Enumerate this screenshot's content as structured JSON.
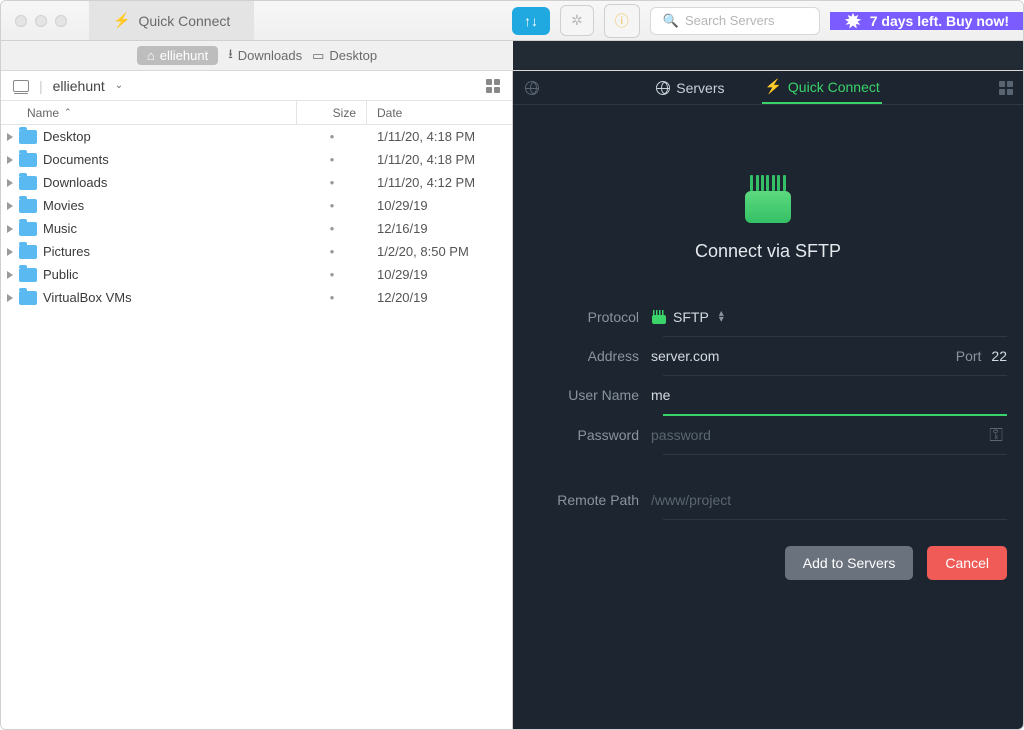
{
  "titlebar": {
    "tab_label": "Quick Connect",
    "search_placeholder": "Search Servers",
    "buy_text": "7 days left. Buy now!"
  },
  "breadcrumbs": [
    {
      "label": "elliehunt",
      "active": true,
      "icon": "home"
    },
    {
      "label": "Downloads",
      "active": false,
      "icon": "download"
    },
    {
      "label": "Desktop",
      "active": false,
      "icon": "desktop"
    }
  ],
  "left": {
    "path_label": "elliehunt",
    "columns": {
      "name": "Name",
      "size": "Size",
      "date": "Date"
    },
    "files": [
      {
        "name": "Desktop",
        "size": "•",
        "date": "1/11/20, 4:18 PM"
      },
      {
        "name": "Documents",
        "size": "•",
        "date": "1/11/20, 4:18 PM"
      },
      {
        "name": "Downloads",
        "size": "•",
        "date": "1/11/20, 4:12 PM"
      },
      {
        "name": "Movies",
        "size": "•",
        "date": "10/29/19"
      },
      {
        "name": "Music",
        "size": "•",
        "date": "12/16/19"
      },
      {
        "name": "Pictures",
        "size": "•",
        "date": "1/2/20, 8:50 PM"
      },
      {
        "name": "Public",
        "size": "•",
        "date": "10/29/19"
      },
      {
        "name": "VirtualBox VMs",
        "size": "•",
        "date": "12/20/19"
      }
    ]
  },
  "right": {
    "tabs": {
      "servers": "Servers",
      "quick": "Quick Connect"
    },
    "title": "Connect via SFTP",
    "labels": {
      "protocol": "Protocol",
      "address": "Address",
      "port": "Port",
      "username": "User Name",
      "password": "Password",
      "remote_path": "Remote Path"
    },
    "values": {
      "protocol": "SFTP",
      "address": "server.com",
      "port": "22",
      "username": "me",
      "password_placeholder": "password",
      "remote_path_placeholder": "/www/project"
    },
    "buttons": {
      "add": "Add to Servers",
      "cancel": "Cancel"
    }
  }
}
